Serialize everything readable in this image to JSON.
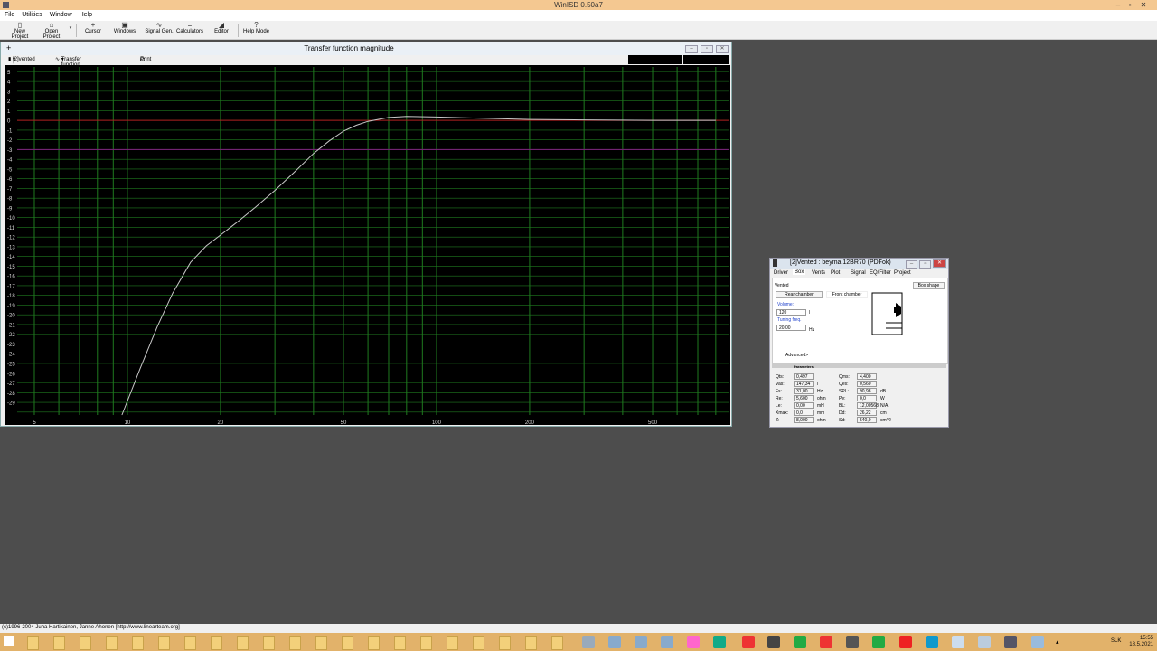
{
  "app": {
    "title": "WinISD 0.50a7"
  },
  "menu": [
    "File",
    "Utilities",
    "Window",
    "Help"
  ],
  "toolbar": [
    {
      "label": "New Project",
      "icon": "new-file-icon"
    },
    {
      "label": "Open Project",
      "icon": "folder-open-icon"
    },
    {
      "label": "Cursor",
      "icon": "cursor-icon"
    },
    {
      "label": "Windows",
      "icon": "windows-icon"
    },
    {
      "label": "Signal Gen.",
      "icon": "signal-icon"
    },
    {
      "label": "Calculators",
      "icon": "calculator-icon"
    },
    {
      "label": "Editor",
      "icon": "editor-icon"
    },
    {
      "label": "Help Mode",
      "icon": "help-icon"
    }
  ],
  "chart_window": {
    "title": "Transfer function magnitude",
    "project_select": "[2]vented :",
    "plot_select": "Transfer function magnitude",
    "print_label": "Print"
  },
  "chart_data": {
    "type": "line",
    "xscale": "log",
    "xlim": [
      4.4,
      880
    ],
    "ylim": [
      -30.3,
      5.5
    ],
    "x_ticks": [
      5,
      10,
      20,
      50,
      100,
      200,
      500
    ],
    "y_ticks": [
      5,
      4,
      3,
      2,
      1,
      0,
      -1,
      -2,
      -3,
      -4,
      -5,
      -6,
      -7,
      -8,
      -9,
      -10,
      -11,
      -12,
      -13,
      -14,
      -15,
      -16,
      -17,
      -18,
      -19,
      -20,
      -21,
      -22,
      -23,
      -24,
      -25,
      -26,
      -27,
      -28,
      -29
    ],
    "grid": true,
    "reference_lines": [
      {
        "y": 0,
        "color": "#b02020"
      },
      {
        "y": -3,
        "color": "#802080"
      }
    ],
    "series": [
      {
        "color": "#c8c8c8",
        "x": [
          9.6,
          11,
          12.5,
          14,
          16,
          18,
          20,
          23,
          26,
          30,
          35,
          40,
          45,
          50,
          55,
          60,
          70,
          80,
          100,
          150,
          200,
          300,
          500,
          800
        ],
        "y": [
          -30.3,
          -25.5,
          -21.2,
          -17.8,
          -14.6,
          -12.9,
          -11.8,
          -10.3,
          -8.9,
          -7.2,
          -5.2,
          -3.4,
          -2.1,
          -1.1,
          -0.5,
          -0.1,
          0.3,
          0.4,
          0.35,
          0.2,
          0.1,
          0.05,
          0.0,
          0.0
        ]
      }
    ]
  },
  "params_window": {
    "title": "[2]Vented : beyma 12BR70 (PDFok)",
    "tabs": [
      "Driver",
      "Box",
      "Vents",
      "Plot",
      "Signal",
      "EQ/Filter",
      "Project"
    ],
    "box_type": "Vented",
    "box_shape_btn": "Box shape",
    "rear_chamber": "Rear chamber",
    "front_chamber": "Front chamber",
    "volume_label": "Volume:",
    "volume_value": "120",
    "volume_unit": "l",
    "tuning_label": "Tuning freq.",
    "tuning_value": "20,00",
    "tuning_unit": "Hz",
    "advanced": "Advanced>",
    "parameters_header": "Parameters",
    "params": [
      {
        "name": "Qts:",
        "value": "0,497",
        "unit": ""
      },
      {
        "name": "Vas:",
        "value": "147,34",
        "unit": "l"
      },
      {
        "name": "Fs:",
        "value": "31,00",
        "unit": "Hz"
      },
      {
        "name": "Re:",
        "value": "5,600",
        "unit": "ohm"
      },
      {
        "name": "Le:",
        "value": "0,00",
        "unit": "mH"
      },
      {
        "name": "Xmax:",
        "value": "0,0",
        "unit": "mm"
      },
      {
        "name": "Z:",
        "value": "8,000",
        "unit": "ohm"
      },
      {
        "name": "Qms:",
        "value": "4,400",
        "unit": ""
      },
      {
        "name": "Qes:",
        "value": "0,560",
        "unit": ""
      },
      {
        "name": "SPL:",
        "value": "90,98",
        "unit": "dB"
      },
      {
        "name": "Pe:",
        "value": "0,0",
        "unit": "W"
      },
      {
        "name": "BL:",
        "value": "12,00568",
        "unit": "N/A"
      },
      {
        "name": "Dd:",
        "value": "26,22",
        "unit": "cm"
      },
      {
        "name": "Sd:",
        "value": "540,0",
        "unit": "cm^2"
      }
    ]
  },
  "statusbar": {
    "text": "(c)1996-2004 Juha Hartikainen, Janne Ahonen [http://www.linearteam.org]"
  },
  "taskbar": {
    "lang": "SLK",
    "time": "15:55",
    "date": "18.5.2021"
  }
}
